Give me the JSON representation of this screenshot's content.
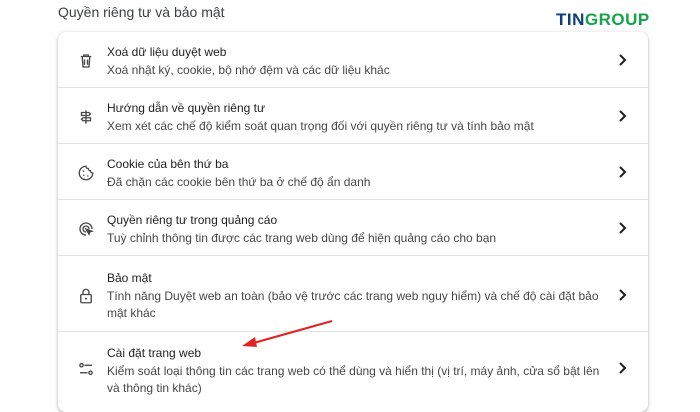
{
  "section_title": "Quyền riêng tư và bảo mật",
  "logo": {
    "part1": "TIN",
    "part2": "GROUP"
  },
  "items": [
    {
      "title": "Xoá dữ liệu duyệt web",
      "subtitle": "Xoá nhật ký, cookie, bộ nhớ đệm và các dữ liệu khác",
      "icon": "trash-icon"
    },
    {
      "title": "Hướng dẫn về quyền riêng tư",
      "subtitle": "Xem xét các chế độ kiểm soát quan trọng đối với quyền riêng tư và tính bảo mật",
      "icon": "signpost-icon"
    },
    {
      "title": "Cookie của bên thứ ba",
      "subtitle": "Đã chặn các cookie bên thứ ba ở chế độ ẩn danh",
      "icon": "cookie-icon"
    },
    {
      "title": "Quyền riêng tư trong quảng cáo",
      "subtitle": "Tuỳ chỉnh thông tin được các trang web dùng để hiện quảng cáo cho bạn",
      "icon": "ad-privacy-icon"
    },
    {
      "title": "Bảo mật",
      "subtitle": "Tính năng Duyệt web an toàn (bảo vệ trước các trang web nguy hiểm) và chế độ cài đặt bảo mật khác",
      "icon": "lock-icon"
    },
    {
      "title": "Cài đặt trang web",
      "subtitle": "Kiểm soát loại thông tin các trang web có thể dùng và hiển thị (vị trí, máy ảnh, cửa sổ bật lên và thông tin khác)",
      "icon": "tune-icon"
    }
  ],
  "colors": {
    "annotation_arrow": "#e02424",
    "logo_blue": "#0d3d7a",
    "logo_green": "#16a34a"
  }
}
